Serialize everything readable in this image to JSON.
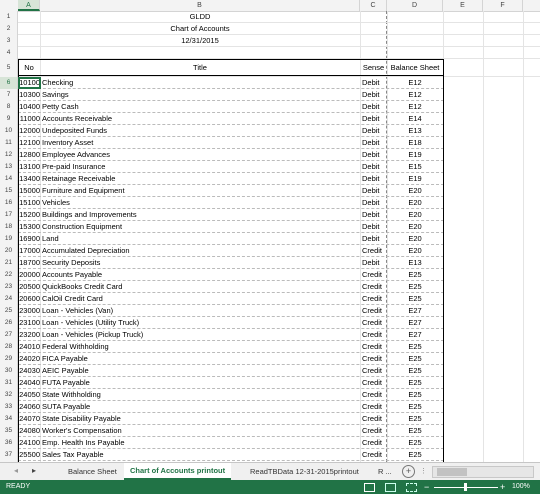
{
  "columns": [
    "A",
    "B",
    "C",
    "D",
    "E",
    "F"
  ],
  "header_rows": {
    "company": "GLDD",
    "report": "Chart of Accounts",
    "date": "12/31/2015"
  },
  "table_headers": {
    "no": "No",
    "title": "Title",
    "sense": "Sense",
    "balance_sheet": "Balance Sheet"
  },
  "rows": [
    {
      "r": "6",
      "no": "10100",
      "title": "Checking",
      "sense": "Debit",
      "bs": "E12"
    },
    {
      "r": "7",
      "no": "10300",
      "title": "Savings",
      "sense": "Debit",
      "bs": "E12"
    },
    {
      "r": "8",
      "no": "10400",
      "title": "Petty Cash",
      "sense": "Debit",
      "bs": "E12"
    },
    {
      "r": "9",
      "no": "11000",
      "title": "Accounts Receivable",
      "sense": "Debit",
      "bs": "E14"
    },
    {
      "r": "10",
      "no": "12000",
      "title": "Undeposited Funds",
      "sense": "Debit",
      "bs": "E13"
    },
    {
      "r": "11",
      "no": "12100",
      "title": "Inventory Asset",
      "sense": "Debit",
      "bs": "E18"
    },
    {
      "r": "12",
      "no": "12800",
      "title": "Employee Advances",
      "sense": "Debit",
      "bs": "E19"
    },
    {
      "r": "13",
      "no": "13100",
      "title": "Pre-paid Insurance",
      "sense": "Debit",
      "bs": "E15"
    },
    {
      "r": "14",
      "no": "13400",
      "title": "Retainage Receivable",
      "sense": "Debit",
      "bs": "E19"
    },
    {
      "r": "15",
      "no": "15000",
      "title": "Furniture and Equipment",
      "sense": "Debit",
      "bs": "E20"
    },
    {
      "r": "16",
      "no": "15100",
      "title": "Vehicles",
      "sense": "Debit",
      "bs": "E20"
    },
    {
      "r": "17",
      "no": "15200",
      "title": "Buildings and Improvements",
      "sense": "Debit",
      "bs": "E20"
    },
    {
      "r": "18",
      "no": "15300",
      "title": "Construction Equipment",
      "sense": "Debit",
      "bs": "E20"
    },
    {
      "r": "19",
      "no": "16900",
      "title": "Land",
      "sense": "Debit",
      "bs": "E20"
    },
    {
      "r": "20",
      "no": "17000",
      "title": "Accumulated Depreciation",
      "sense": "Credit",
      "bs": "E20"
    },
    {
      "r": "21",
      "no": "18700",
      "title": "Security Deposits",
      "sense": "Debit",
      "bs": "E13"
    },
    {
      "r": "22",
      "no": "20000",
      "title": "Accounts Payable",
      "sense": "Credit",
      "bs": "E25"
    },
    {
      "r": "23",
      "no": "20500",
      "title": "QuickBooks Credit Card",
      "sense": "Credit",
      "bs": "E25"
    },
    {
      "r": "24",
      "no": "20600",
      "title": "CalOil Credit Card",
      "sense": "Credit",
      "bs": "E25"
    },
    {
      "r": "25",
      "no": "23000",
      "title": "Loan - Vehicles (Van)",
      "sense": "Credit",
      "bs": "E27"
    },
    {
      "r": "26",
      "no": "23100",
      "title": "Loan - Vehicles (Utility Truck)",
      "sense": "Credit",
      "bs": "E27"
    },
    {
      "r": "27",
      "no": "23200",
      "title": "Loan - Vehicles (Pickup Truck)",
      "sense": "Credit",
      "bs": "E27"
    },
    {
      "r": "28",
      "no": "24010",
      "title": "Federal Withholding",
      "sense": "Credit",
      "bs": "E25"
    },
    {
      "r": "29",
      "no": "24020",
      "title": "FICA Payable",
      "sense": "Credit",
      "bs": "E25"
    },
    {
      "r": "30",
      "no": "24030",
      "title": "AEIC Payable",
      "sense": "Credit",
      "bs": "E25"
    },
    {
      "r": "31",
      "no": "24040",
      "title": "FUTA Payable",
      "sense": "Credit",
      "bs": "E25"
    },
    {
      "r": "32",
      "no": "24050",
      "title": "State Withholding",
      "sense": "Credit",
      "bs": "E25"
    },
    {
      "r": "33",
      "no": "24060",
      "title": "SUTA Payable",
      "sense": "Credit",
      "bs": "E25"
    },
    {
      "r": "34",
      "no": "24070",
      "title": "State Disability Payable",
      "sense": "Credit",
      "bs": "E25"
    },
    {
      "r": "35",
      "no": "24080",
      "title": "Worker's Compensation",
      "sense": "Credit",
      "bs": "E25"
    },
    {
      "r": "36",
      "no": "24100",
      "title": "Emp. Health Ins Payable",
      "sense": "Credit",
      "bs": "E25"
    },
    {
      "r": "37",
      "no": "25500",
      "title": "Sales Tax Payable",
      "sense": "Credit",
      "bs": "E25"
    }
  ],
  "row_numbers_top": [
    "1",
    "2",
    "3",
    "4",
    "5"
  ],
  "sheet_tabs": {
    "tab1": "Balance Sheet",
    "tab2": "Chart of Accounts printout",
    "tab3": "ReadTBData 12-31-2015printout",
    "tab4": "R ..."
  },
  "status": {
    "ready": "READY",
    "zoom": "100%"
  }
}
